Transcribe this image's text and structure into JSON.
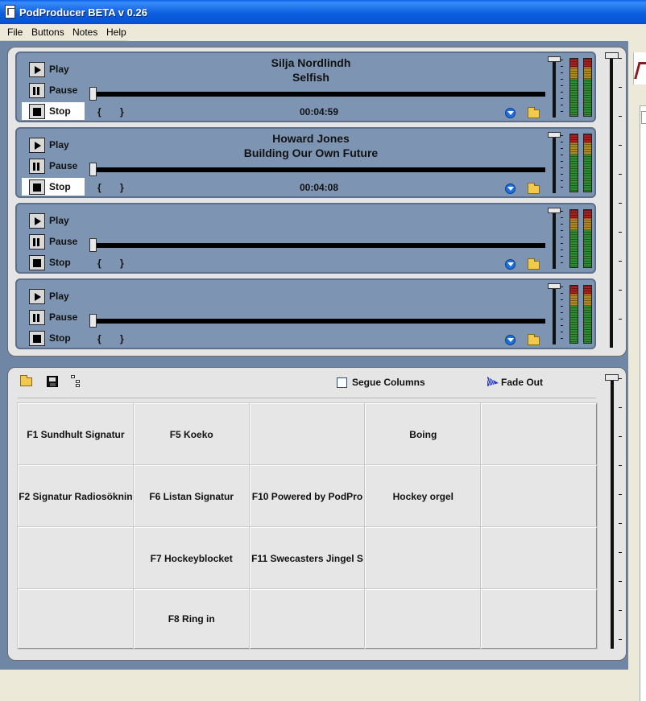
{
  "window": {
    "title": "PodProducer BETA v 0.26"
  },
  "menu": [
    "File",
    "Buttons",
    "Notes",
    "Help"
  ],
  "decks": [
    {
      "artist": "Silja Nordlindh",
      "song": "Selfish",
      "time": "00:04:59",
      "play_label": "Play",
      "pause_label": "Pause",
      "stop_label": "Stop",
      "cue_in": "{",
      "cue_out": "}",
      "stop_highlight": true
    },
    {
      "artist": "Howard Jones",
      "song": "Building Our Own Future",
      "time": "00:04:08",
      "play_label": "Play",
      "pause_label": "Pause",
      "stop_label": "Stop",
      "cue_in": "{",
      "cue_out": "}",
      "stop_highlight": true
    },
    {
      "artist": "",
      "song": "",
      "time": "",
      "play_label": "Play",
      "pause_label": "Pause",
      "stop_label": "Stop",
      "cue_in": "{",
      "cue_out": "}",
      "stop_highlight": false
    },
    {
      "artist": "",
      "song": "",
      "time": "",
      "play_label": "Play",
      "pause_label": "Pause",
      "stop_label": "Stop",
      "cue_in": "{",
      "cue_out": "}",
      "stop_highlight": false
    }
  ],
  "cart": {
    "segue_label": "Segue Columns",
    "segue_checked": false,
    "fade_out_label": "Fade Out",
    "buttons": [
      [
        "F1 Sundhult Signatur",
        "F5 Koeko",
        "",
        "Boing",
        ""
      ],
      [
        "F2 Signatur Radiosöknin",
        "F6  Listan Signatur",
        "F10 Powered by PodPro",
        "Hockey orgel",
        ""
      ],
      [
        "",
        "F7 Hockeyblocket",
        "F11 Swecasters Jingel S",
        "",
        ""
      ],
      [
        "",
        "F8 Ring in",
        "",
        "",
        ""
      ]
    ]
  },
  "colors": {
    "deck_bg": "#7d95b3",
    "panel_bg": "#e5e5e5",
    "desktop_bg": "#6f87a5",
    "titlebar": "#0a5ee6"
  },
  "icons": [
    "play-icon",
    "pause-icon",
    "stop-icon",
    "download-icon",
    "folder-icon",
    "save-icon",
    "tree-icon",
    "fade-out-icon"
  ]
}
